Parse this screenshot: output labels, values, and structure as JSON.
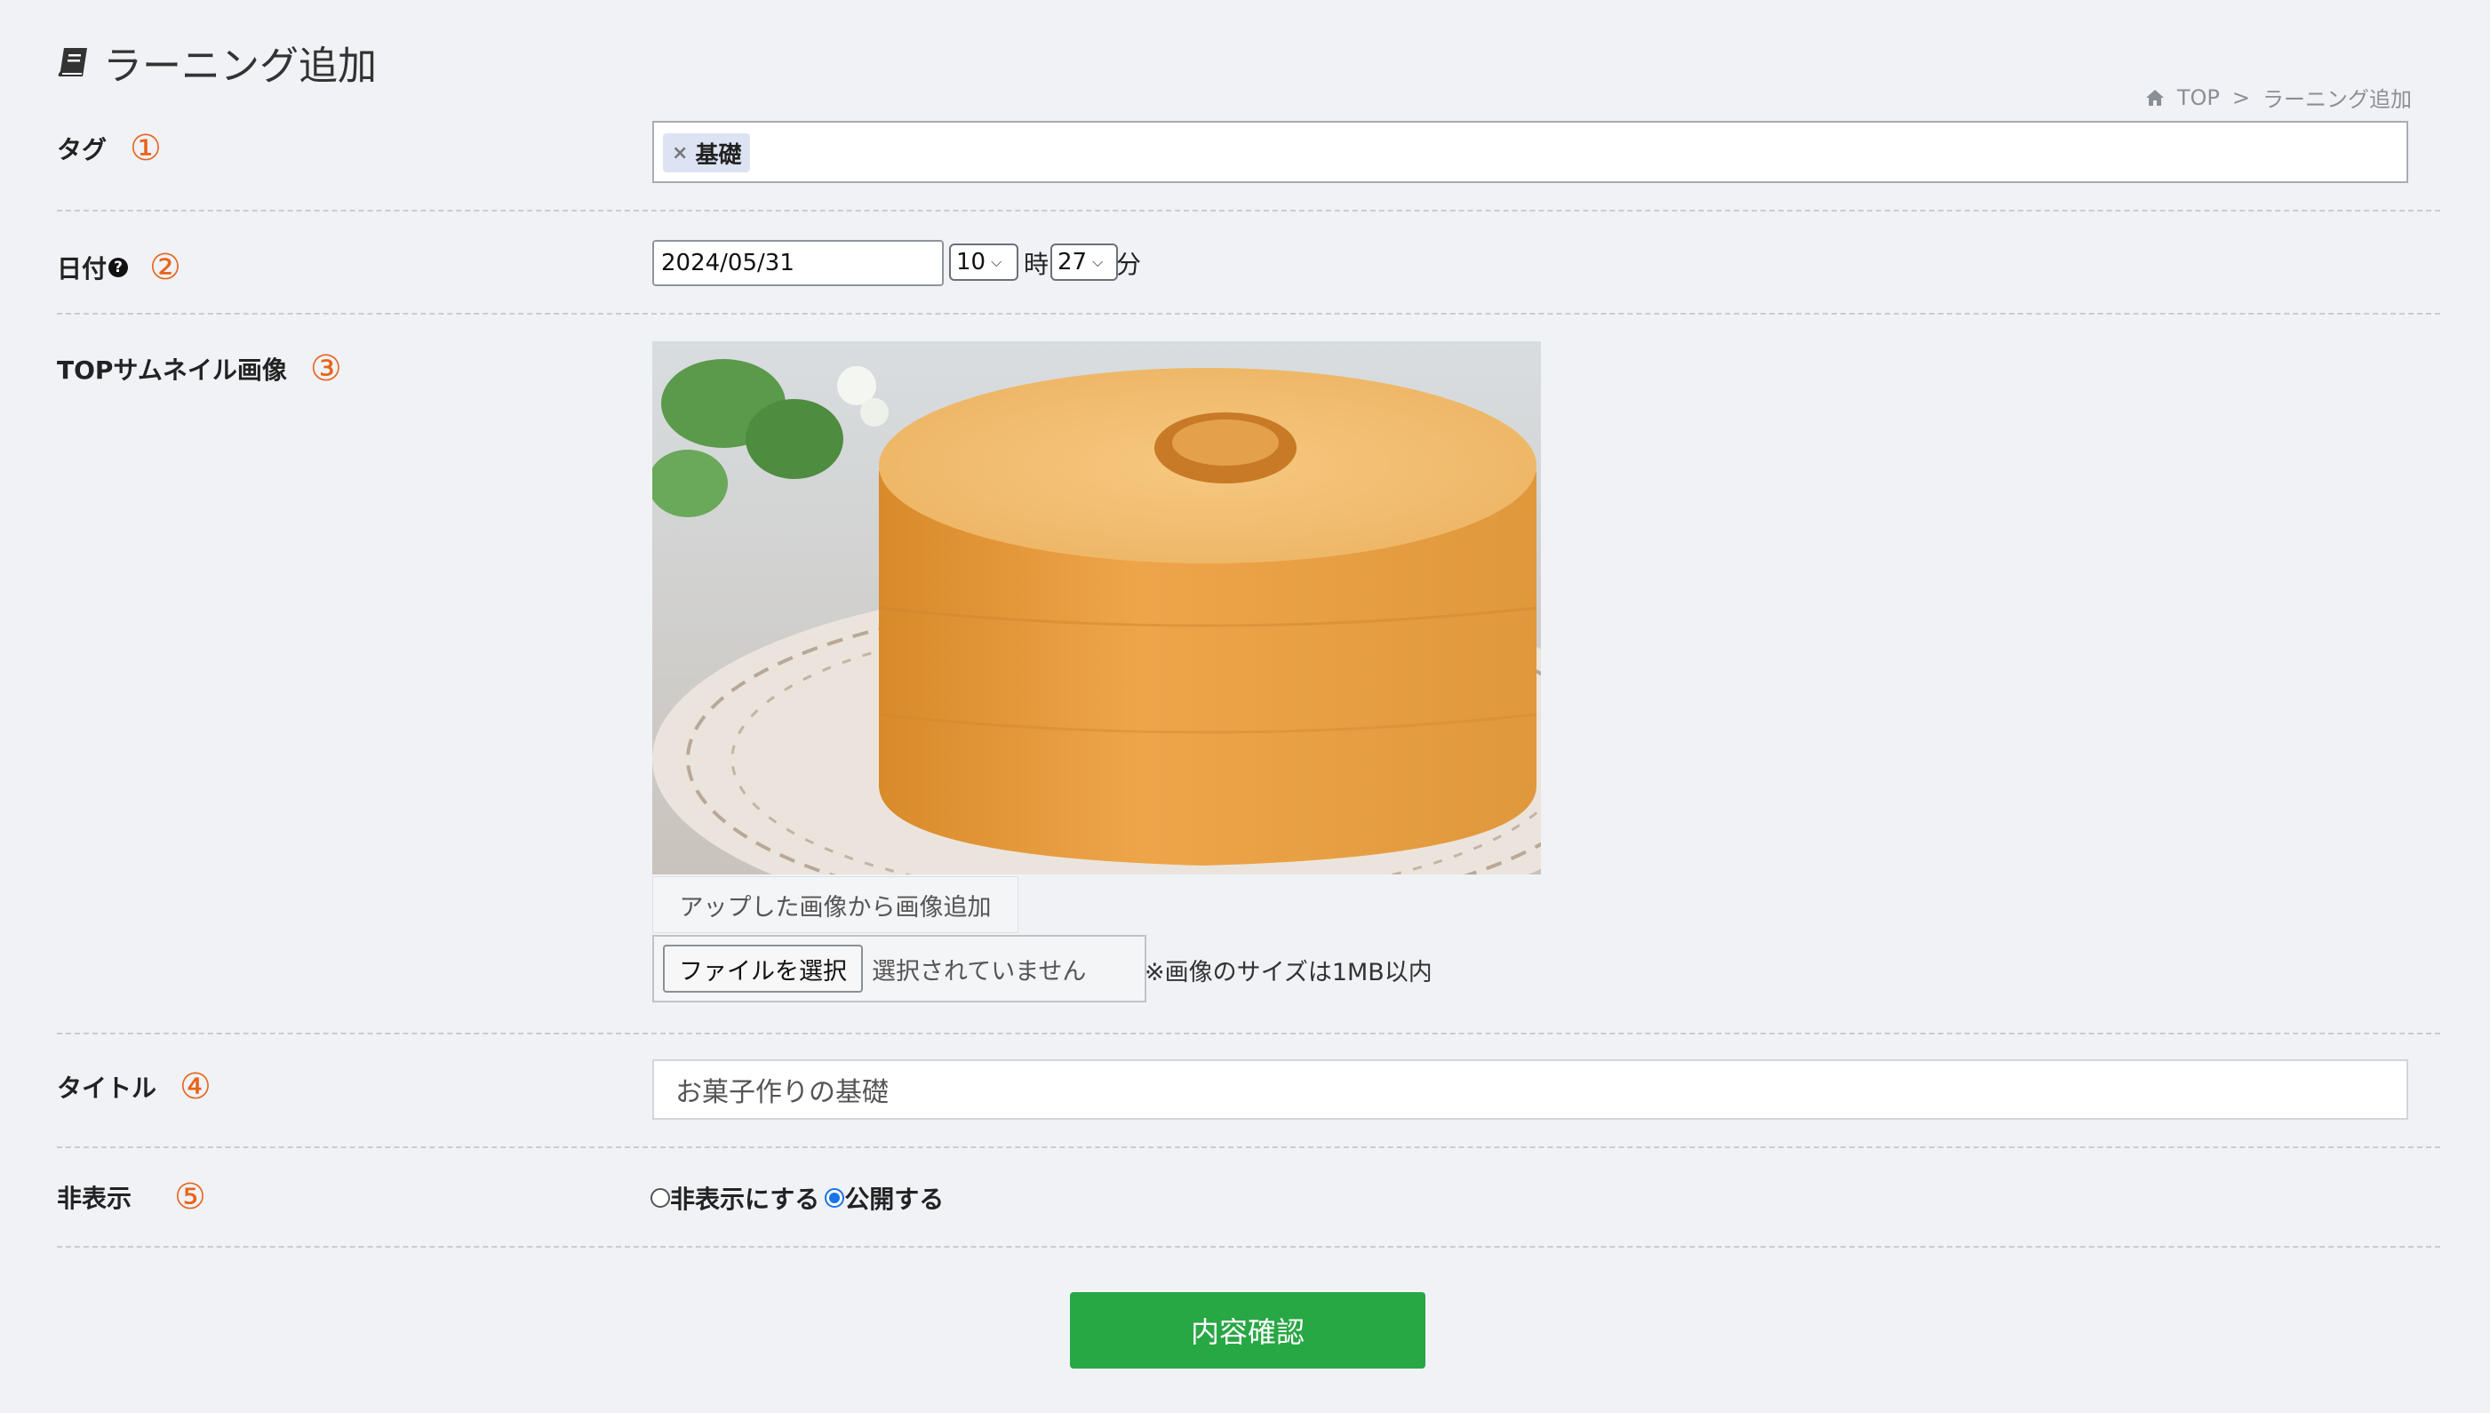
{
  "header": {
    "title": "ラーニング追加",
    "icon": "book-icon"
  },
  "breadcrumb": {
    "home": "TOP",
    "separator": ">",
    "current": "ラーニング追加"
  },
  "rows": {
    "tag": {
      "label": "タグ",
      "marker": "①",
      "chips": [
        {
          "label": "基礎",
          "remove": "×"
        }
      ]
    },
    "date": {
      "label": "日付",
      "marker": "②",
      "help": "?",
      "value": "2024/05/31",
      "hour": "10",
      "hour_unit": "時",
      "minute": "27",
      "minute_unit": "分"
    },
    "thumbnail": {
      "label": "TOPサムネイル画像",
      "marker": "③",
      "gallery_button": "アップした画像から画像追加",
      "file_button": "ファイルを選択",
      "file_status": "選択されていません",
      "size_note": "※画像のサイズは1MB以内"
    },
    "title": {
      "label": "タイトル",
      "marker": "④",
      "value": "お菓子作りの基礎"
    },
    "visibility": {
      "label": "非表示",
      "marker": "⑤",
      "options": [
        {
          "label": "非表示にする",
          "selected": false
        },
        {
          "label": "公開する",
          "selected": true
        }
      ]
    }
  },
  "confirm_button": "内容確認",
  "colors": {
    "accent_green": "#28a745",
    "marker_orange": "#e8641c",
    "background": "#f0f2f6"
  }
}
